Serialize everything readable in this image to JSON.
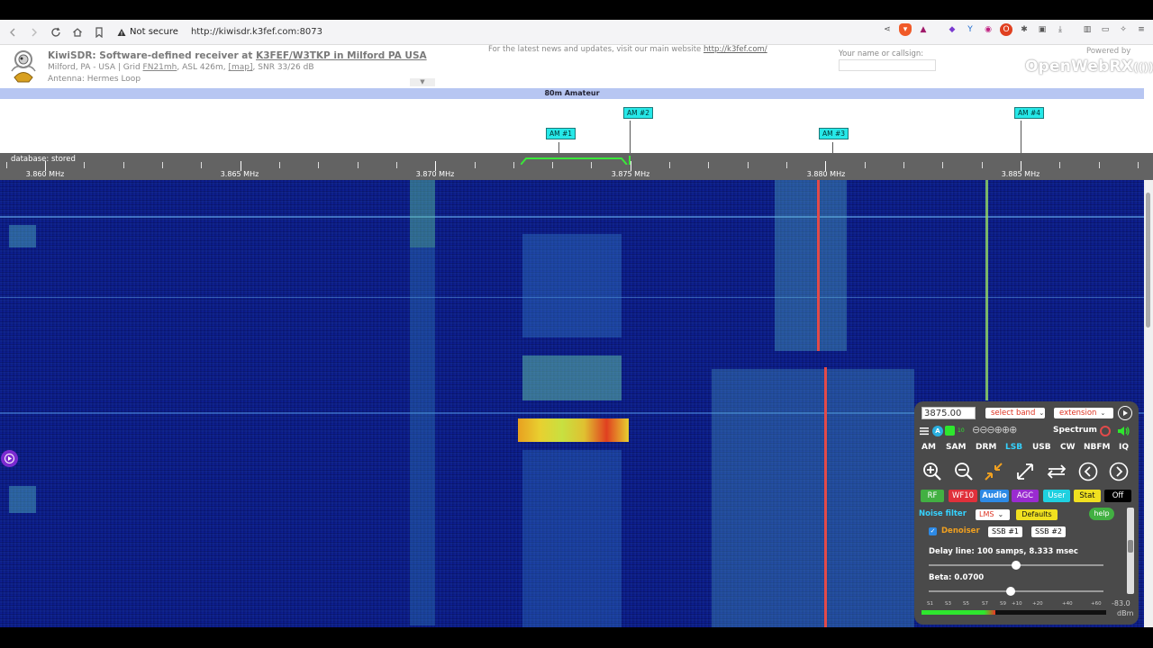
{
  "browser": {
    "security": "Not secure",
    "url": "http://kiwisdr.k3fef.com:8073"
  },
  "header": {
    "title_prefix": "KiwiSDR: Software-defined receiver at ",
    "title_link": "K3FEF/W3TKP in Milford PA USA",
    "loc_prefix": "Milford, PA - USA | Grid ",
    "grid": "FN21mh",
    "loc_mid": ", ASL 426m, ",
    "map": "[map]",
    "loc_suffix": ", SNR 33/26 dB",
    "antenna": "Antenna: Hermes Loop",
    "news_prefix": "For the latest news and updates, visit our main website ",
    "news_link": "http://k3fef.com/",
    "callsign_label": "Your name or callsign:",
    "powered_by": "Powered by",
    "owrx_logo": "OpenWebRX"
  },
  "band_label": "80m Amateur",
  "markers": [
    "AM #1",
    "AM #2",
    "AM #3",
    "AM #4"
  ],
  "scale": {
    "database_label": "database: stored",
    "freq_labels": [
      "3.860 MHz",
      "3.865 MHz",
      "3.870 MHz",
      "3.875 MHz",
      "3.880 MHz",
      "3.885 MHz"
    ]
  },
  "control": {
    "frequency": "3875.00",
    "select_band": "select band",
    "extension": "extension",
    "spectrum_label": "Spectrum",
    "modes": [
      "AM",
      "SAM",
      "DRM",
      "LSB",
      "USB",
      "CW",
      "NBFM",
      "IQ"
    ],
    "active_mode": "LSB",
    "tabs": [
      "RF",
      "WF10",
      "Audio",
      "AGC",
      "User",
      "Stat",
      "Off"
    ],
    "noise_filter_label": "Noise filter",
    "noise_filter_value": "LMS",
    "defaults": "Defaults",
    "help": "help",
    "denoiser": "Denoiser",
    "ssb1": "SSB #1",
    "ssb2": "SSB #2",
    "delay_line": "Delay line: 100 samps, 8.333 msec",
    "beta": "Beta: 0.0700",
    "smeter_scale": [
      "S1",
      "S3",
      "S5",
      "S7",
      "S9",
      "+10",
      "+20",
      "+40",
      "+60"
    ],
    "dbm_value": "-83.0",
    "dbm_unit": "dBm",
    "smeter_level": 0.4
  },
  "colors": {
    "marker_bg": "#26e8e8",
    "band_strip": "#b7c6f2",
    "active_mode": "#35d2ff",
    "rf_tab": "#42b042",
    "wf_tab": "#e0303a",
    "audio_tab": "#2d8ae6",
    "agc_tab": "#9a2bd0",
    "user_tab": "#1fd0e0",
    "stat_tab": "#f0e020",
    "off_tab": "#000000"
  }
}
